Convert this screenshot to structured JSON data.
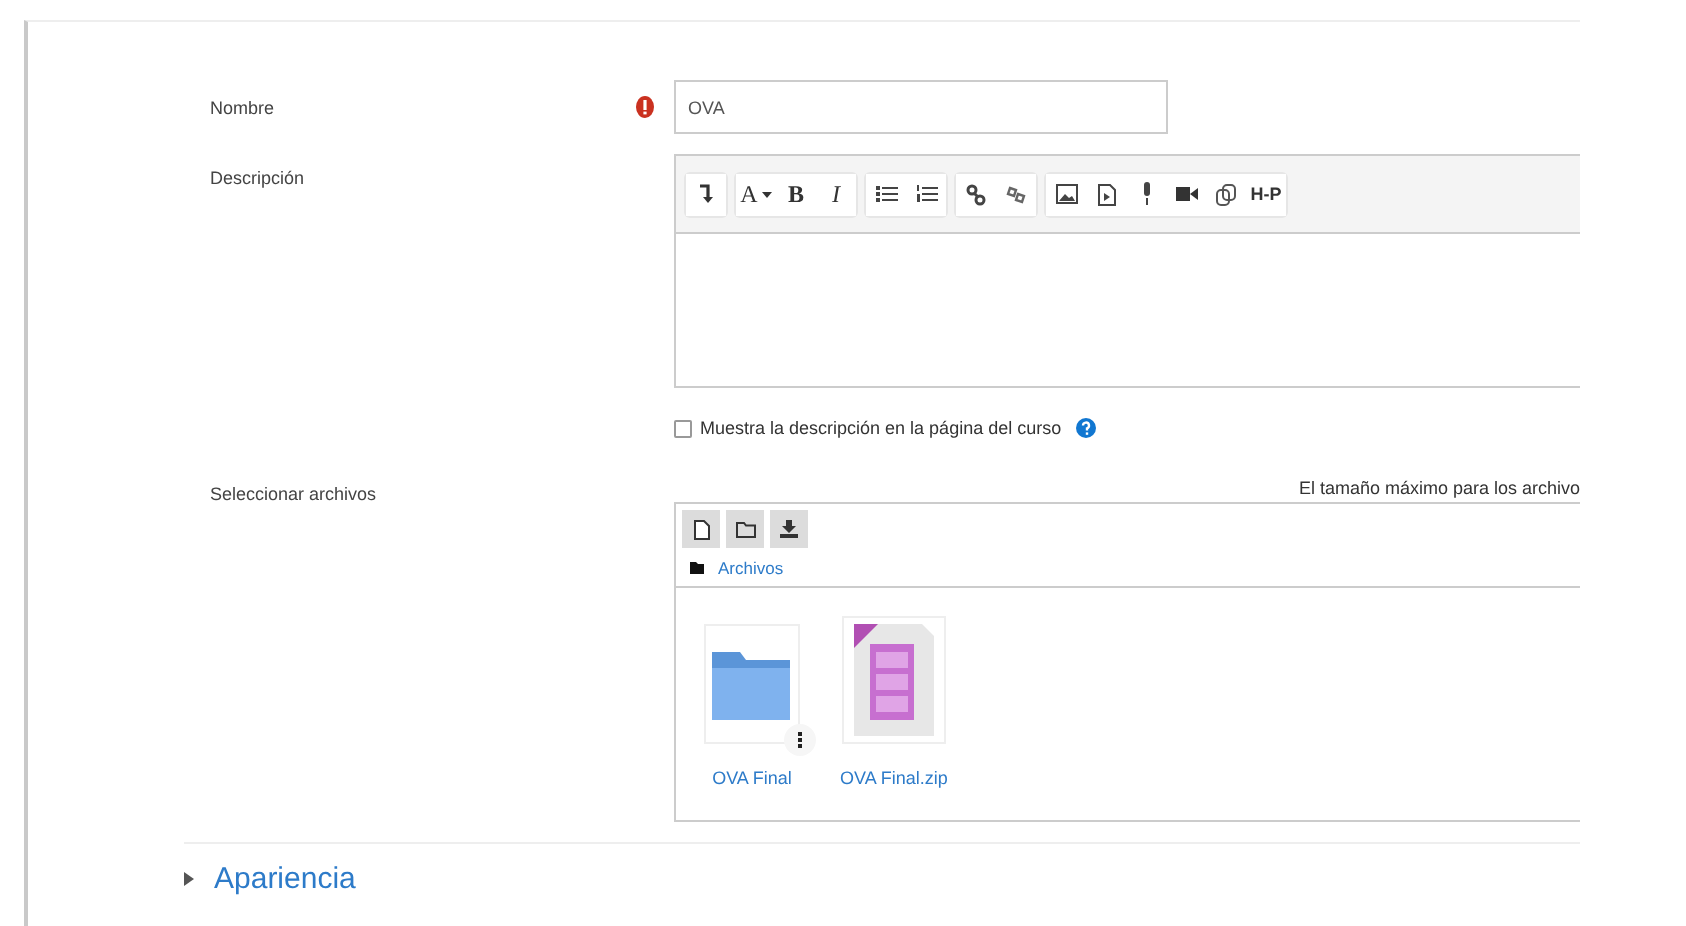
{
  "form": {
    "name_field": {
      "label": "Nombre",
      "required": true,
      "value": "OVA"
    },
    "description": {
      "label": "Descripción",
      "toolbar": [
        [
          {
            "kind": "collapse"
          }
        ],
        [
          {
            "kind": "font",
            "label": "A"
          },
          {
            "kind": "bold",
            "label": "B"
          },
          {
            "kind": "italic",
            "label": "I"
          }
        ],
        [
          {
            "kind": "bullets"
          },
          {
            "kind": "numbers"
          }
        ],
        [
          {
            "kind": "link"
          },
          {
            "kind": "unlink"
          }
        ],
        [
          {
            "kind": "image"
          },
          {
            "kind": "media"
          },
          {
            "kind": "mic"
          },
          {
            "kind": "video"
          },
          {
            "kind": "files"
          },
          {
            "kind": "logo",
            "label": "H-P"
          }
        ]
      ]
    },
    "show_description": {
      "label": "Muestra la descripción en la página del curso",
      "checked": false,
      "help": true
    },
    "files": {
      "label": "Seleccionar archivos",
      "max_size_note": "El tamaño máximo para los archivo",
      "toolbar": [
        {
          "kind": "file"
        },
        {
          "kind": "folder"
        },
        {
          "kind": "download"
        }
      ],
      "breadcrumb": "Archivos",
      "items": [
        {
          "name": "OVA Final",
          "kind": "folder",
          "menu": true
        },
        {
          "name": "OVA Final.zip",
          "kind": "zip",
          "menu": false
        }
      ]
    },
    "sections": [
      {
        "title": "Apariencia",
        "expanded": false
      }
    ]
  }
}
